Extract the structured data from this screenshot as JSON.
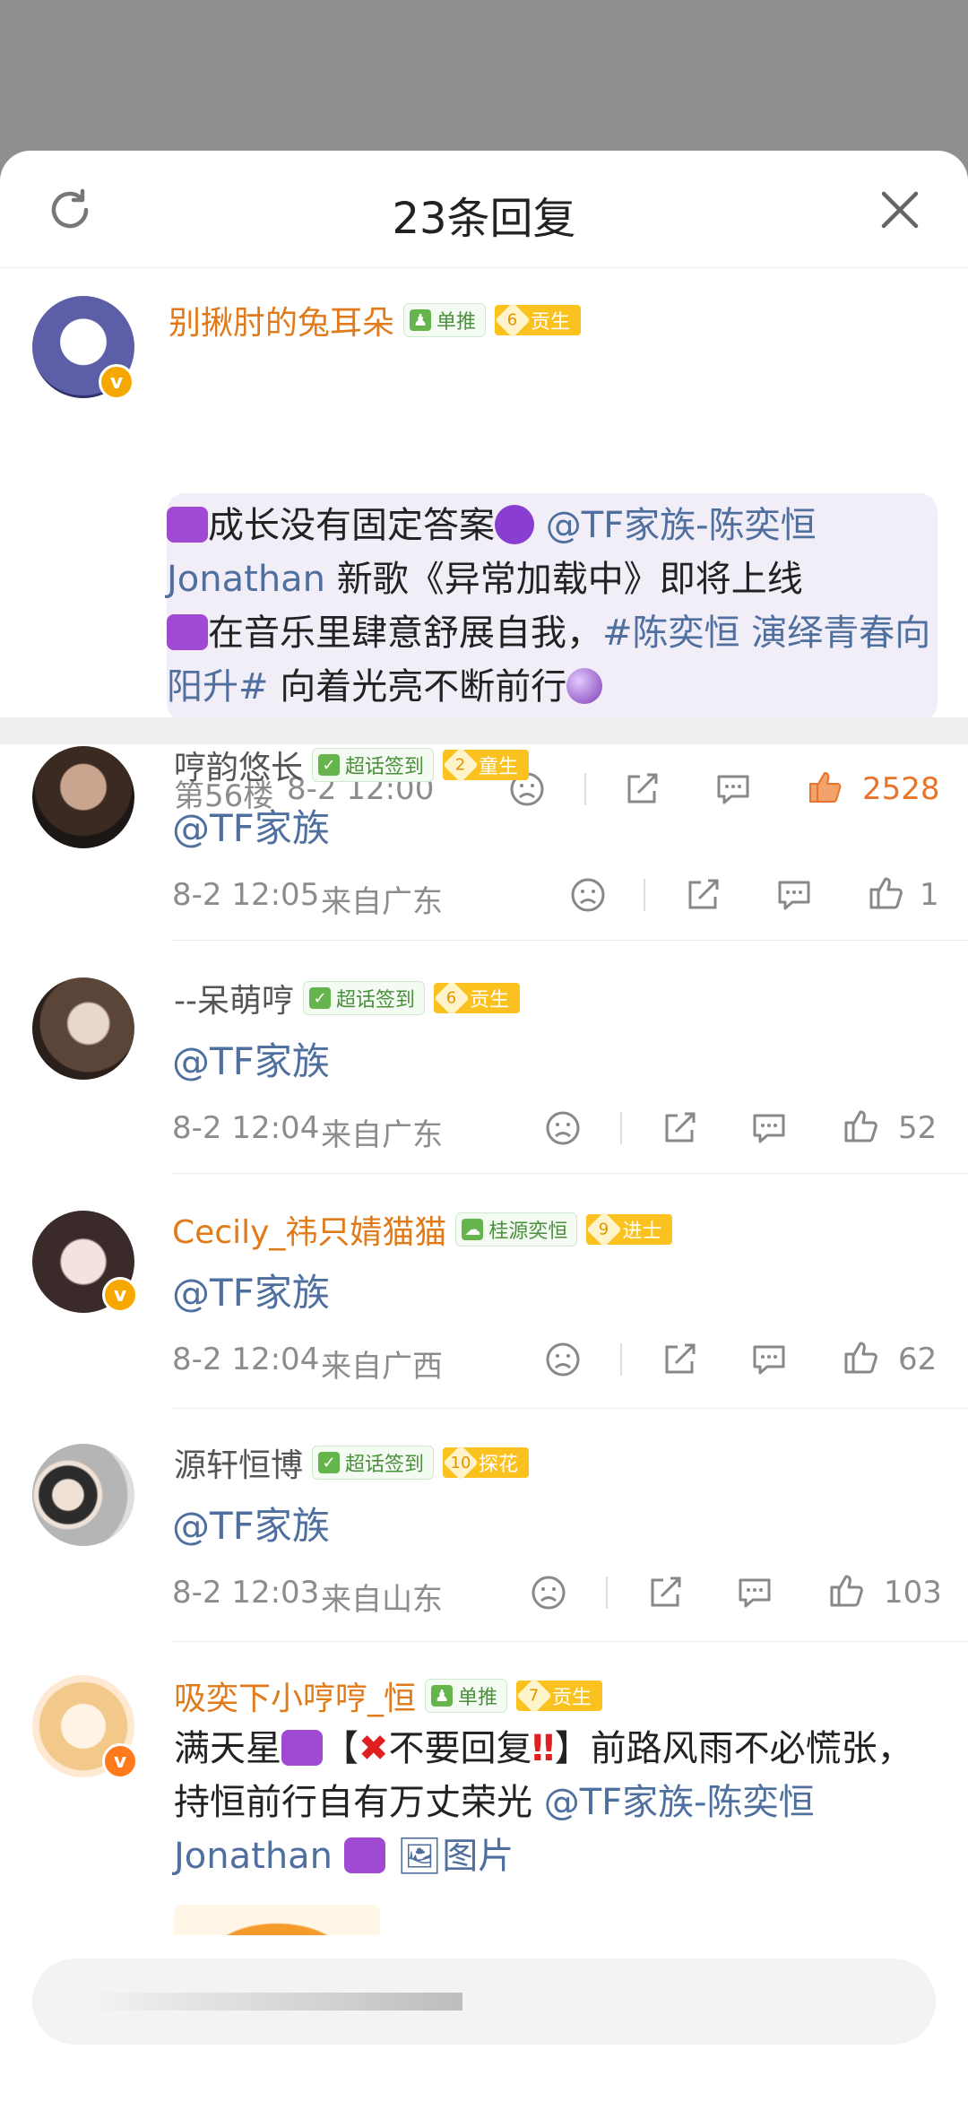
{
  "header": {
    "title": "23条回复"
  },
  "main_comment": {
    "user": "别揪肘的兔耳朵",
    "tag": "单推",
    "rank_level": "6",
    "rank_title": "贡生",
    "text_1": "成长没有固定答案",
    "mention": "@TF家族-陈奕恒 Jonathan",
    "text_2": " 新歌《异常加载中》即将上线",
    "text_3": "在音乐里肆意舒展自我，",
    "topic": "#陈奕恒 演绎青春向阳升#",
    "text_4": " 向着光亮不断前行",
    "floor": "第56楼",
    "time": "8-2 12:00",
    "likes": "2528"
  },
  "replies": [
    {
      "user": "哼韵悠长",
      "tag": "超话签到",
      "rank_level": "2",
      "rank_title": "童生",
      "text": "@TF家族",
      "time": "8-2 12:05",
      "location": "来自广东",
      "likes": "1"
    },
    {
      "user": "--呆萌哼",
      "tag": "超话签到",
      "rank_level": "6",
      "rank_title": "贡生",
      "text": "@TF家族",
      "time": "8-2 12:04",
      "location": "来自广东",
      "likes": "52"
    },
    {
      "user": "Cecily_祎只婧猫猫",
      "tag": "桂源奕恒",
      "rank_level": "9",
      "rank_title": "进士",
      "text": "@TF家族",
      "time": "8-2 12:04",
      "location": "来自广西",
      "likes": "62"
    },
    {
      "user": "源轩恒博",
      "tag": "超话签到",
      "rank_level": "10",
      "rank_title": "探花",
      "text": "@TF家族",
      "time": "8-2 12:03",
      "location": "来自山东",
      "likes": "103"
    },
    {
      "user": "吸奕下小哼哼_恒",
      "tag": "单推",
      "rank_level": "7",
      "rank_title": "贡生",
      "text_1": "满天星",
      "text_2": "【",
      "text_3": "不要回复",
      "text_4": "】前路风雨不必慌张，持恒前行自有万丈荣光 ",
      "mention": "@TF家族-陈奕恒Jonathan",
      "image_label": "图片"
    }
  ],
  "colors": {
    "accent_orange": "#e07a1a",
    "link_blue": "#4f6f9f",
    "like_active": "#e8742a"
  }
}
